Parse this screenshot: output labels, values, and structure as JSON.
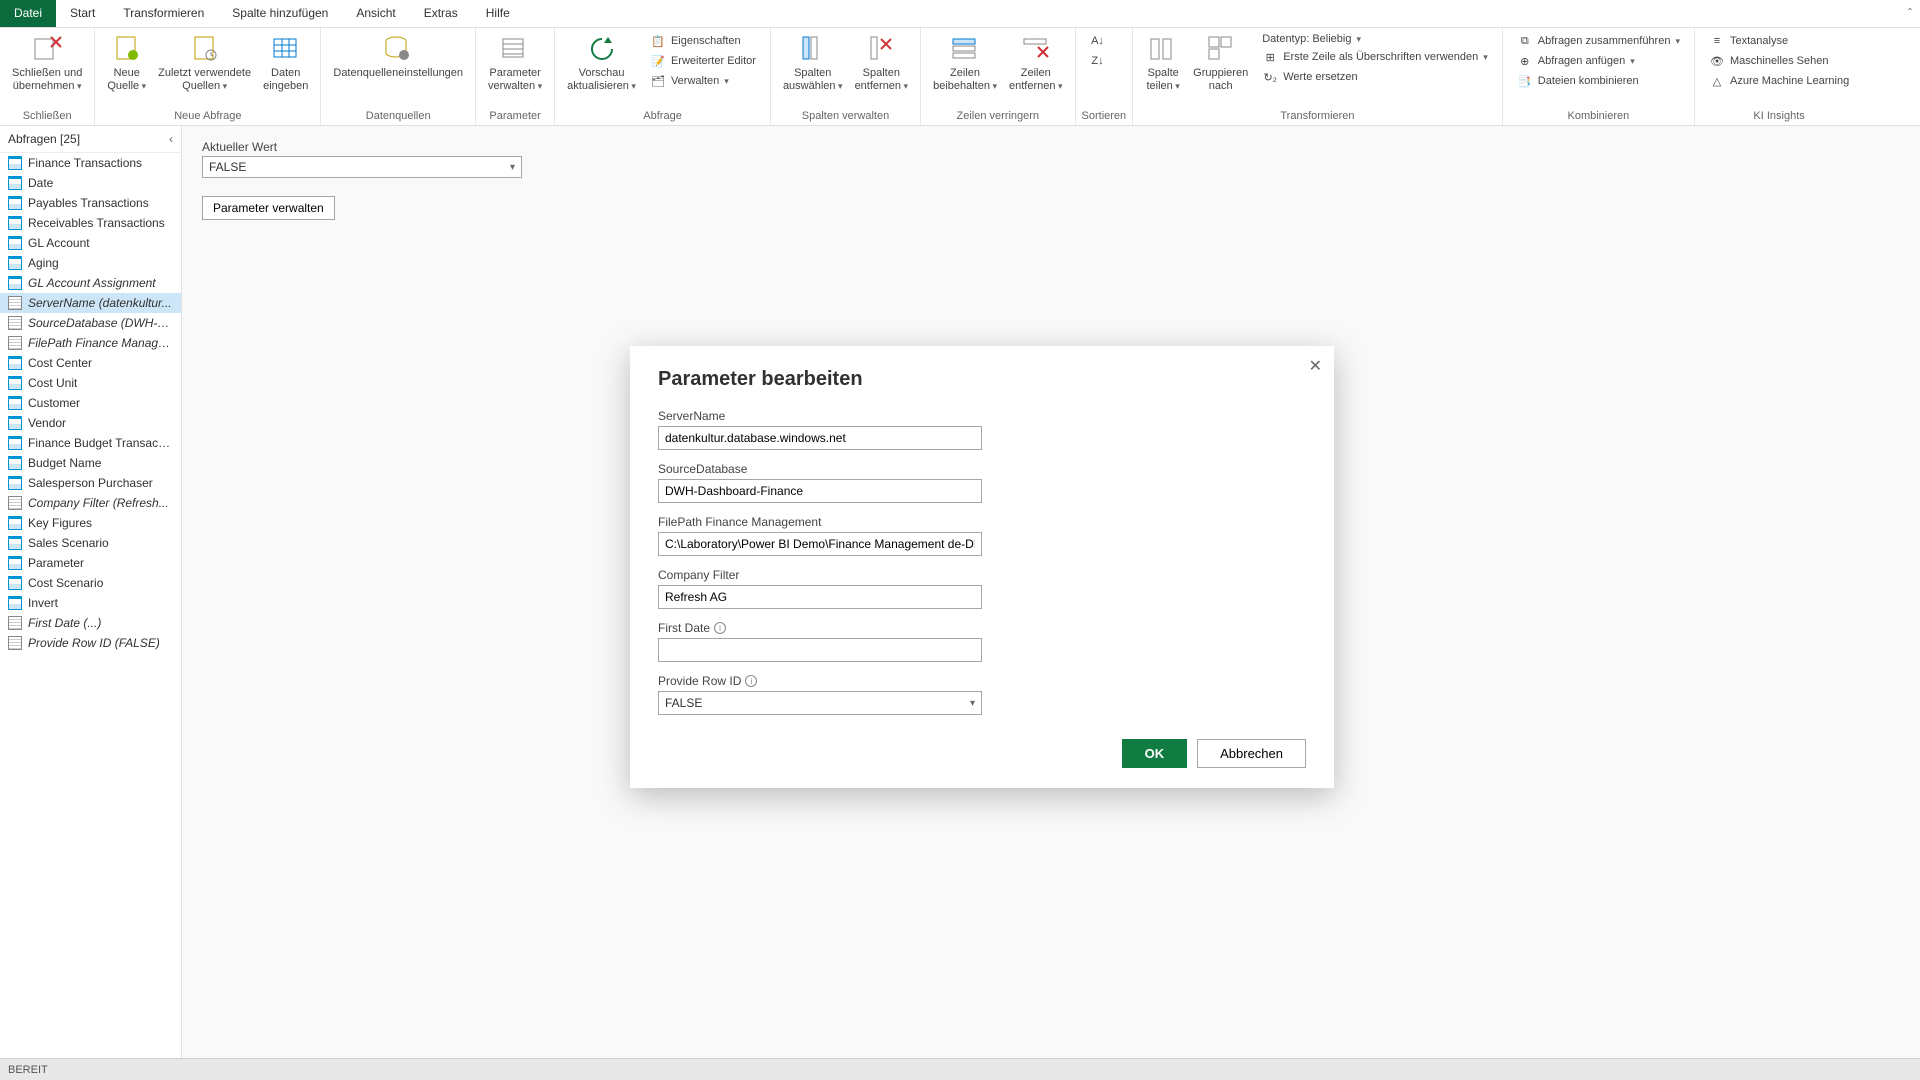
{
  "menu": {
    "file": "Datei",
    "start": "Start",
    "transform": "Transformieren",
    "addcol": "Spalte hinzufügen",
    "view": "Ansicht",
    "extras": "Extras",
    "help": "Hilfe",
    "up": "ˆ"
  },
  "ribbon": {
    "close": {
      "label": "Schließen und\nübernehmen",
      "group": "Schließen"
    },
    "newquery": {
      "newsource": "Neue\nQuelle",
      "recent": "Zuletzt verwendete\nQuellen",
      "enterdata": "Daten\neingeben",
      "group": "Neue Abfrage"
    },
    "datasources": {
      "settings": "Datenquelleneinstellungen",
      "group": "Datenquellen"
    },
    "parameter": {
      "manage": "Parameter\nverwalten",
      "group": "Parameter"
    },
    "query": {
      "refresh": "Vorschau\naktualisieren",
      "properties": "Eigenschaften",
      "advanced": "Erweiterter Editor",
      "manage": "Verwalten",
      "group": "Abfrage"
    },
    "columns": {
      "choose": "Spalten\nauswählen",
      "remove": "Spalten\nentfernen",
      "group": "Spalten verwalten"
    },
    "rows": {
      "keep": "Zeilen\nbeibehalten",
      "remove": "Zeilen\nentfernen",
      "group": "Zeilen verringern"
    },
    "sort": {
      "group": "Sortieren"
    },
    "transform": {
      "split": "Spalte\nteilen",
      "groupby": "Gruppieren\nnach",
      "datatype": "Datentyp: Beliebig",
      "firstrow": "Erste Zeile als Überschriften verwenden",
      "replace": "Werte ersetzen",
      "group": "Transformieren"
    },
    "combine": {
      "merge": "Abfragen zusammenführen",
      "append": "Abfragen anfügen",
      "combinefiles": "Dateien kombinieren",
      "group": "Kombinieren"
    },
    "ai": {
      "textanalytics": "Textanalyse",
      "vision": "Maschinelles Sehen",
      "azureml": "Azure Machine Learning",
      "group": "KI Insights"
    }
  },
  "queries": {
    "header": "Abfragen [25]",
    "items": [
      {
        "label": "Finance Transactions",
        "type": "tbl",
        "italic": false,
        "selected": false
      },
      {
        "label": "Date",
        "type": "tbl",
        "italic": false,
        "selected": false
      },
      {
        "label": "Payables Transactions",
        "type": "tbl",
        "italic": false,
        "selected": false
      },
      {
        "label": "Receivables Transactions",
        "type": "tbl",
        "italic": false,
        "selected": false
      },
      {
        "label": "GL Account",
        "type": "tbl",
        "italic": false,
        "selected": false
      },
      {
        "label": "Aging",
        "type": "tbl",
        "italic": false,
        "selected": false
      },
      {
        "label": "GL Account Assignment",
        "type": "tbl",
        "italic": true,
        "selected": false
      },
      {
        "label": "ServerName (datenkultur...",
        "type": "param",
        "italic": true,
        "selected": true
      },
      {
        "label": "SourceDatabase (DWH-D...",
        "type": "param",
        "italic": true,
        "selected": false
      },
      {
        "label": "FilePath Finance Manage...",
        "type": "param",
        "italic": true,
        "selected": false
      },
      {
        "label": "Cost Center",
        "type": "tbl",
        "italic": false,
        "selected": false
      },
      {
        "label": "Cost Unit",
        "type": "tbl",
        "italic": false,
        "selected": false
      },
      {
        "label": "Customer",
        "type": "tbl",
        "italic": false,
        "selected": false
      },
      {
        "label": "Vendor",
        "type": "tbl",
        "italic": false,
        "selected": false
      },
      {
        "label": "Finance Budget Transacti...",
        "type": "tbl",
        "italic": false,
        "selected": false
      },
      {
        "label": "Budget Name",
        "type": "tbl",
        "italic": false,
        "selected": false
      },
      {
        "label": "Salesperson Purchaser",
        "type": "tbl",
        "italic": false,
        "selected": false
      },
      {
        "label": "Company Filter (Refresh...",
        "type": "param",
        "italic": true,
        "selected": false
      },
      {
        "label": "Key Figures",
        "type": "tbl",
        "italic": false,
        "selected": false
      },
      {
        "label": "Sales Scenario",
        "type": "tbl",
        "italic": false,
        "selected": false
      },
      {
        "label": "Parameter",
        "type": "tbl",
        "italic": false,
        "selected": false
      },
      {
        "label": "Cost Scenario",
        "type": "tbl",
        "italic": false,
        "selected": false
      },
      {
        "label": "Invert",
        "type": "tbl",
        "italic": false,
        "selected": false
      },
      {
        "label": "First Date (...)",
        "type": "param",
        "italic": true,
        "selected": false
      },
      {
        "label": "Provide Row ID (FALSE)",
        "type": "param",
        "italic": true,
        "selected": false
      }
    ]
  },
  "main": {
    "currentvalue_label": "Aktueller Wert",
    "currentvalue": "FALSE",
    "manageparam": "Parameter verwalten"
  },
  "dialog": {
    "title": "Parameter bearbeiten",
    "fields": {
      "servername": {
        "label": "ServerName",
        "value": "datenkultur.database.windows.net"
      },
      "sourcedb": {
        "label": "SourceDatabase",
        "value": "DWH-Dashboard-Finance"
      },
      "filepath": {
        "label": "FilePath Finance Management",
        "value": "C:\\Laboratory\\Power BI Demo\\Finance Management de-DE."
      },
      "company": {
        "label": "Company Filter",
        "value": "Refresh AG"
      },
      "firstdate": {
        "label": "First Date",
        "value": ""
      },
      "rowid": {
        "label": "Provide Row ID",
        "value": "FALSE"
      }
    },
    "ok": "OK",
    "cancel": "Abbrechen"
  },
  "status": "BEREIT"
}
